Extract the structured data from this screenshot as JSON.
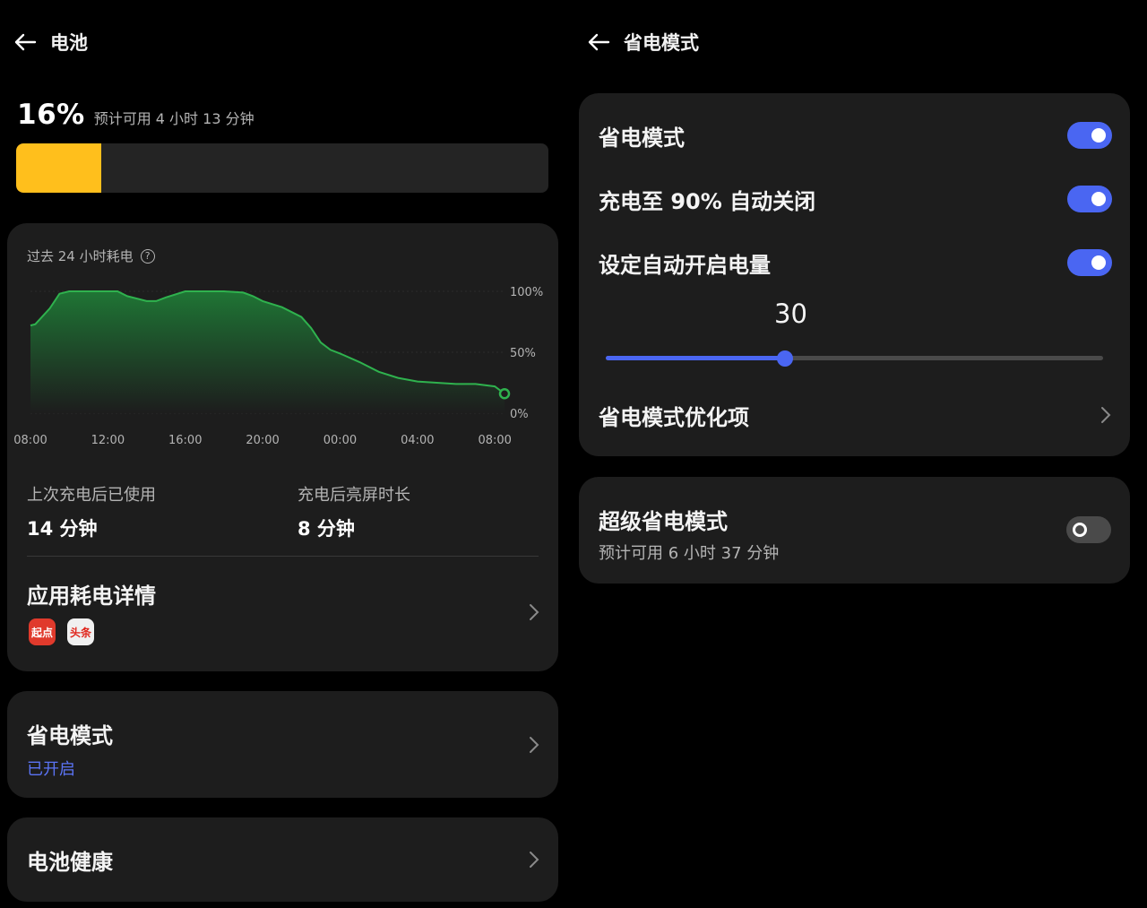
{
  "left": {
    "header": {
      "title": "电池"
    },
    "battery": {
      "percent_text": "16%",
      "level": 0.16,
      "estimate": "预计可用 4 小时 13 分钟",
      "bar_color": "#ffbf1c"
    },
    "chart_title": "过去 24 小时耗电",
    "chart_data": {
      "type": "area",
      "x_ticks": [
        "08:00",
        "12:00",
        "16:00",
        "20:00",
        "00:00",
        "04:00",
        "08:00"
      ],
      "y_ticks": [
        "100%",
        "50%",
        "0%"
      ],
      "ylim": [
        0,
        100
      ],
      "grid": true,
      "line_color": "#2fb24e",
      "series": [
        {
          "x": [
            0,
            0.25,
            1,
            1.5,
            2,
            3,
            4,
            4.5,
            5,
            6,
            6.5,
            7,
            8,
            8.5,
            9,
            10,
            11,
            11.5,
            12,
            13,
            14,
            14.5,
            15,
            15.5,
            16,
            17,
            18,
            19,
            20,
            21,
            22,
            23,
            24
          ],
          "y": [
            72,
            73,
            86,
            98,
            100,
            100,
            100,
            100,
            96,
            92,
            92,
            95,
            100,
            100,
            100,
            100,
            99,
            96,
            92,
            87,
            79,
            70,
            58,
            52,
            49,
            42,
            34,
            29,
            26,
            25,
            24,
            24,
            22
          ],
          "end_point": {
            "x": 24.5,
            "y": 16
          }
        }
      ]
    },
    "stats": {
      "used_label": "上次充电后已使用",
      "used_value": "14 分钟",
      "screen_label": "充电后亮屏时长",
      "screen_value": "8 分钟"
    },
    "app_usage": {
      "title": "应用耗电详情",
      "apps": [
        {
          "name": "起点",
          "label": "起点",
          "bg": "#e03a2c"
        },
        {
          "name": "头条",
          "label": "头条",
          "bg": "#f0f0f0",
          "fg": "#e0241b"
        }
      ]
    },
    "power_saving": {
      "title": "省电模式",
      "status": "已开启"
    },
    "battery_health": {
      "title": "电池健康"
    }
  },
  "right": {
    "header": {
      "title": "省电模式"
    },
    "settings": {
      "power_saving": {
        "label": "省电模式",
        "on": true
      },
      "auto_off": {
        "label": "充电至 90% 自动关闭",
        "on": true
      },
      "auto_on": {
        "label": "设定自动开启电量",
        "on": true
      },
      "threshold": {
        "value": "30",
        "fraction": 0.36
      },
      "optimize": {
        "label": "省电模式优化项"
      }
    },
    "super_saving": {
      "title": "超级省电模式",
      "estimate": "预计可用 6 小时 37 分钟",
      "on": false
    }
  },
  "colors": {
    "accent": "#4a66f2",
    "card": "#1d1d1d",
    "green": "#2fb24e"
  }
}
